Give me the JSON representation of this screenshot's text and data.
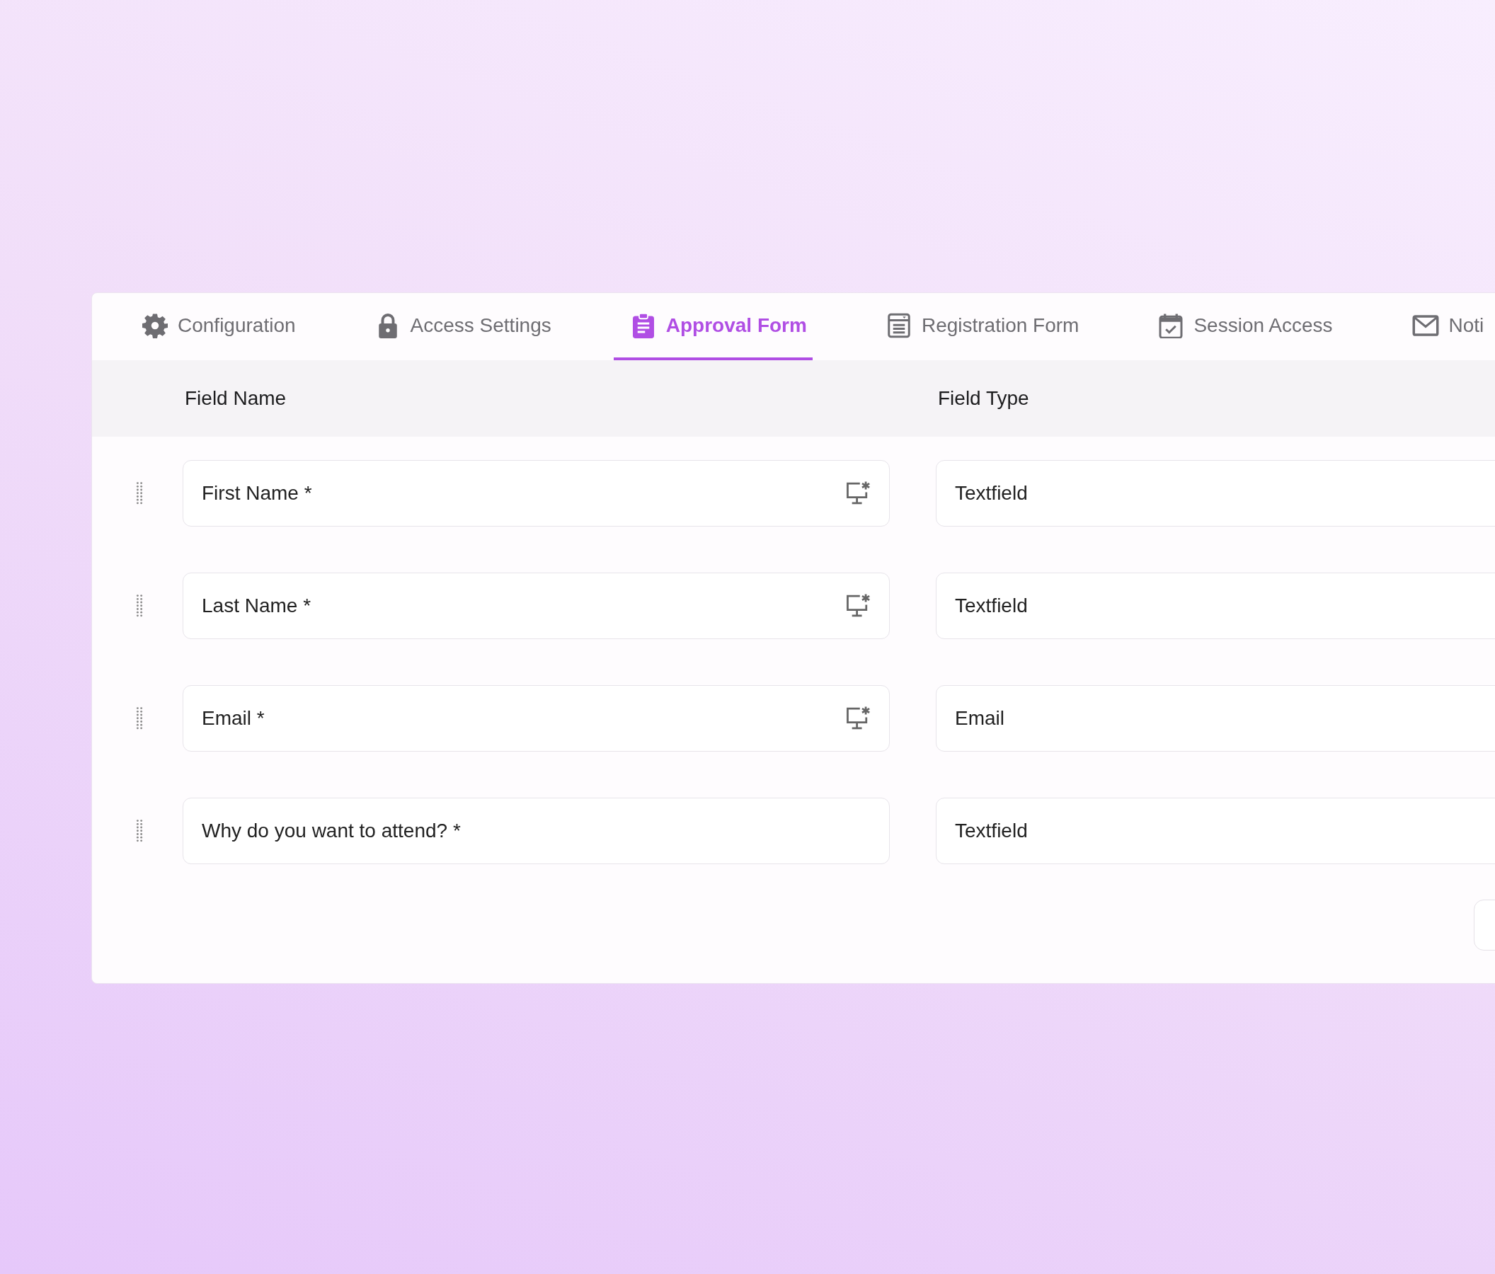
{
  "tabs": [
    {
      "label": "Configuration",
      "selected": false
    },
    {
      "label": "Access Settings",
      "selected": false
    },
    {
      "label": "Approval Form",
      "selected": true
    },
    {
      "label": "Registration Form",
      "selected": false
    },
    {
      "label": "Session Access",
      "selected": false
    },
    {
      "label": "Noti",
      "selected": false
    }
  ],
  "table": {
    "columns": [
      "Field Name",
      "Field Type"
    ],
    "rows": [
      {
        "name": "First Name *",
        "type": "Textfield",
        "show_icon": true
      },
      {
        "name": "Last Name *",
        "type": "Textfield",
        "show_icon": true
      },
      {
        "name": "Email *",
        "type": "Email",
        "show_icon": true
      },
      {
        "name": "Why do you want to attend? *",
        "type": "Textfield",
        "show_icon": false
      }
    ]
  }
}
